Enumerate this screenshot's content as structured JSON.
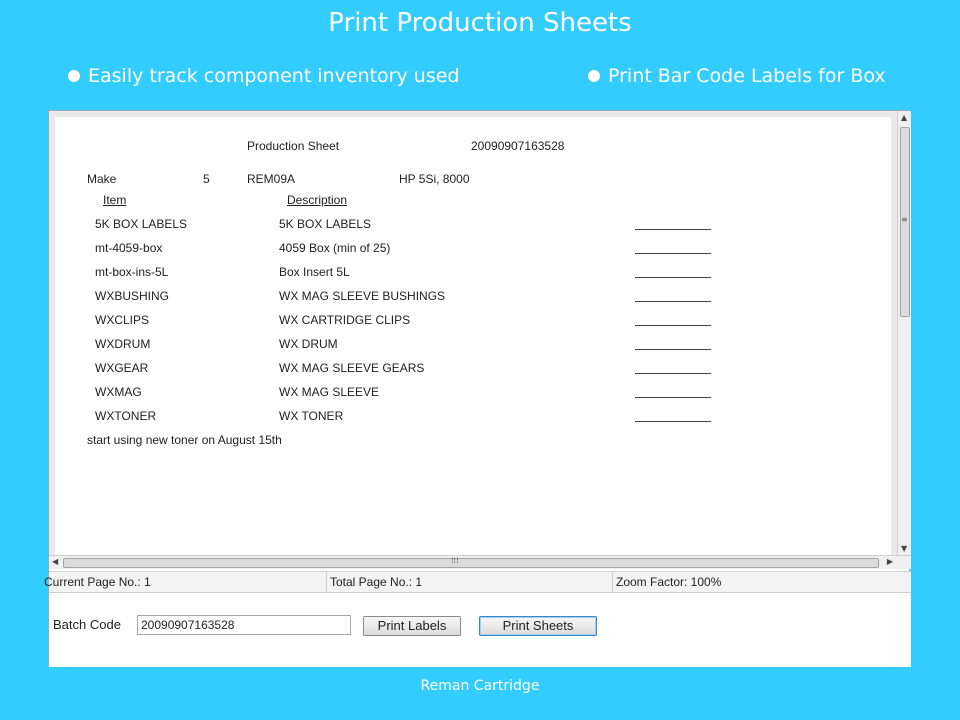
{
  "slide": {
    "title": "Print Production Sheets",
    "bullets": [
      "Easily track component inventory used",
      "Print Bar Code Labels for Box"
    ],
    "footer": "Reman Cartridge"
  },
  "sheet": {
    "title": "Production Sheet",
    "batch_id": "20090907163528",
    "make_label": "Make",
    "make_qty": "5",
    "model": "REM09A",
    "printer": "HP 5Si, 8000",
    "col_item": "Item",
    "col_description": "Description",
    "rows": [
      {
        "item": "5K BOX LABELS",
        "description": "5K BOX LABELS"
      },
      {
        "item": "mt-4059-box",
        "description": "4059 Box  (min of 25)"
      },
      {
        "item": "mt-box-ins-5L",
        "description": "Box Insert 5L"
      },
      {
        "item": "WXBUSHING",
        "description": "WX MAG SLEEVE BUSHINGS"
      },
      {
        "item": "WXCLIPS",
        "description": "WX CARTRIDGE CLIPS"
      },
      {
        "item": "WXDRUM",
        "description": "WX DRUM"
      },
      {
        "item": "WXGEAR",
        "description": "WX MAG SLEEVE GEARS"
      },
      {
        "item": "WXMAG",
        "description": "WX MAG SLEEVE"
      },
      {
        "item": "WXTONER",
        "description": "WX TONER"
      }
    ],
    "note": "start using new toner on August 15th"
  },
  "status": {
    "current_page": "Current Page No.: 1",
    "total_page": "Total Page No.: 1",
    "zoom": "Zoom Factor: 100%"
  },
  "controls": {
    "batch_label": "Batch Code",
    "batch_value": "20090907163528",
    "print_labels": "Print Labels",
    "print_sheets": "Print Sheets"
  },
  "icons": {
    "bullet": "bullet-dot-icon",
    "scroll_up": "arrow-up-icon",
    "scroll_down": "arrow-down-icon",
    "scroll_left": "arrow-left-icon",
    "scroll_right": "arrow-right-icon"
  },
  "colors": {
    "background": "#33ccff",
    "text_on_background": "#ffffff"
  }
}
